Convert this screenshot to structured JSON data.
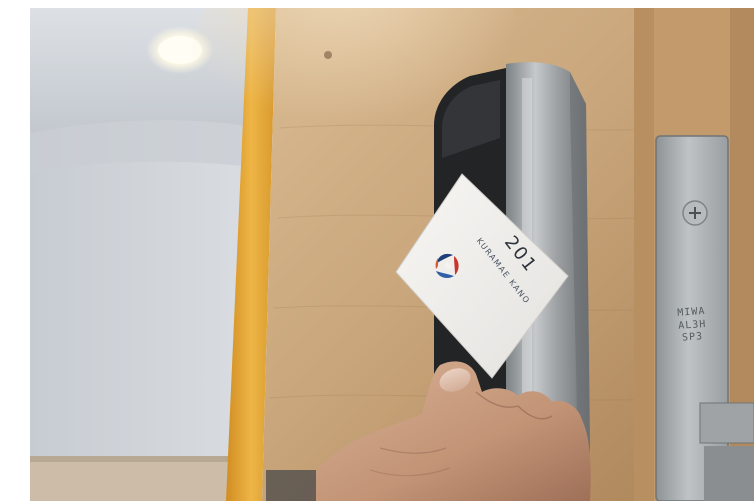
{
  "photo": {
    "scene": "hand holding a hotel key card against an electronic door lock",
    "card": {
      "hotel_name": "KURAMAE KANO",
      "room_number": "201",
      "logo": "circular-ribbon-logo"
    },
    "lock_plate": {
      "brand": "MIWA",
      "model_line1": "AL3H",
      "model_line2": "SP3"
    },
    "colors": {
      "wall": "#c8ccd2",
      "door_wood": "#c9a57b",
      "door_edge": "#e0a83a",
      "lock_metal": "#a4a8ab",
      "card": "#f1efec",
      "skin": "#caa086"
    }
  }
}
